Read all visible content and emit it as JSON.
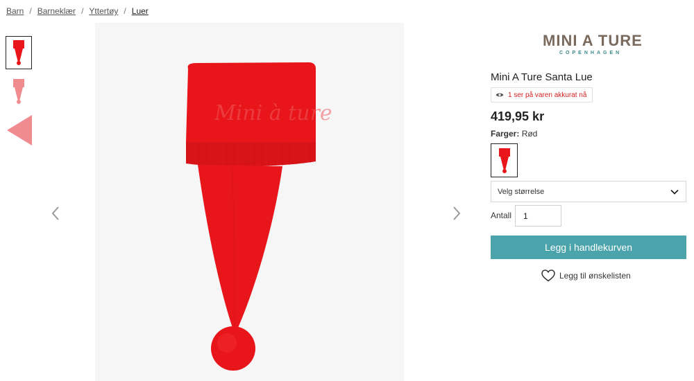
{
  "breadcrumb": {
    "items": [
      "Barn",
      "Barneklær",
      "Yttertøy",
      "Luer"
    ],
    "separator": "/"
  },
  "product": {
    "brand_word": "MINI A TURE",
    "brand_sub": "COPENHAGEN",
    "title": "Mini A Ture Santa Lue",
    "viewers_text": "1 ser på varen akkurat nå",
    "price": "419,95 kr",
    "colors_label": "Farger:",
    "color_value": "Rød",
    "hat_knit_text": "Mini à ture"
  },
  "size_select": {
    "placeholder": "Velg størrelse"
  },
  "quantity": {
    "label": "Antall",
    "value": "1"
  },
  "actions": {
    "add_to_cart": "Legg i handlekurven",
    "wishlist": "Legg til ønskelisten"
  },
  "colors": {
    "hat_red": "#e8161b",
    "hat_pink": "#f08b90",
    "accent": "#4ba4ab",
    "viewers_red": "#d32020",
    "logo_brown": "#7a6a5e",
    "logo_teal": "#3d8a8a"
  },
  "icons": {
    "eye": "eye-icon",
    "heart": "heart-icon",
    "chevron": "chevron-down-icon",
    "prev": "chevron-left-icon",
    "next": "chevron-right-icon"
  }
}
